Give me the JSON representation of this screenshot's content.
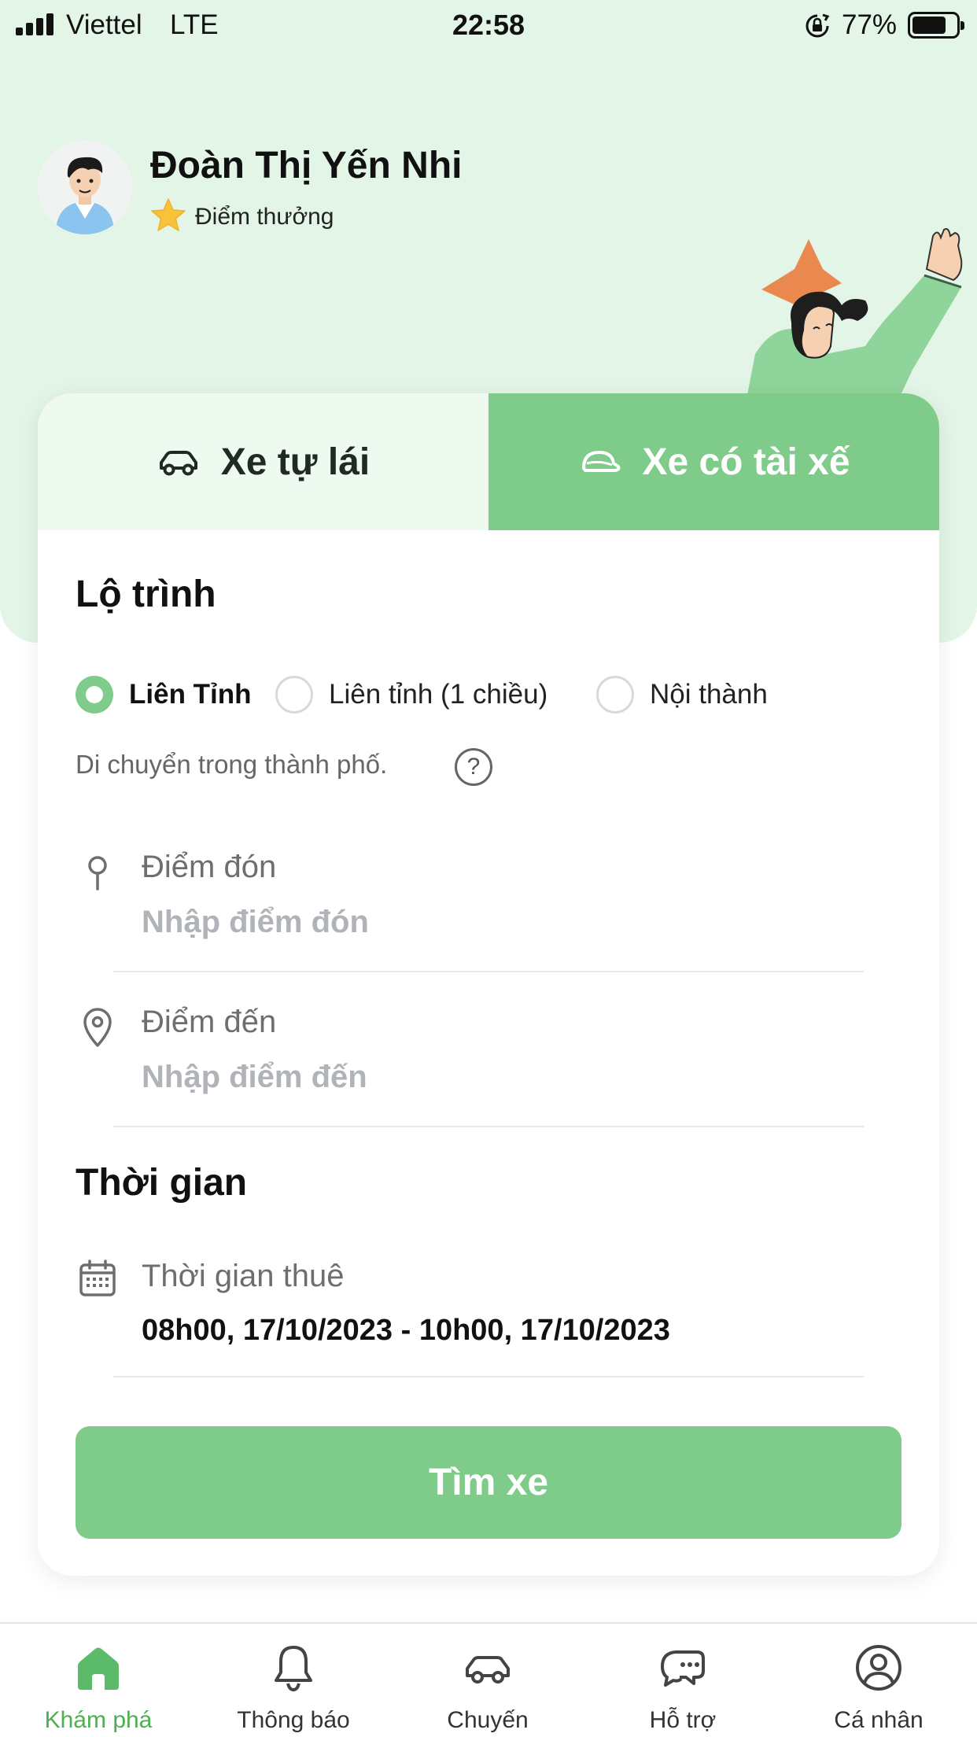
{
  "status_bar": {
    "carrier": "Viettel",
    "network": "LTE",
    "time": "22:58",
    "battery_percent": "77%",
    "battery_level": 0.77
  },
  "profile": {
    "name": "Đoàn Thị Yến Nhi",
    "points_label": "Điểm thưởng"
  },
  "tabs": {
    "self_drive": "Xe tự lái",
    "with_driver": "Xe có tài xế",
    "active": "with_driver"
  },
  "route": {
    "title": "Lộ trình",
    "options": [
      {
        "label": "Liên Tỉnh",
        "checked": true
      },
      {
        "label": "Liên tỉnh (1 chiều)",
        "checked": false
      },
      {
        "label": "Nội thành",
        "checked": false
      }
    ],
    "hint": "Di chuyển trong thành phố.",
    "pickup": {
      "label": "Điểm đón",
      "placeholder": "Nhập điểm đón"
    },
    "destination": {
      "label": "Điểm đến",
      "placeholder": "Nhập điểm đến"
    }
  },
  "time": {
    "title": "Thời gian",
    "rental_label": "Thời gian thuê",
    "rental_value": "08h00, 17/10/2023 - 10h00, 17/10/2023"
  },
  "search_button": "Tìm xe",
  "bottom_nav": [
    {
      "label": "Khám phá",
      "icon": "home-icon",
      "active": true
    },
    {
      "label": "Thông báo",
      "icon": "bell-icon",
      "active": false
    },
    {
      "label": "Chuyến",
      "icon": "car-icon",
      "active": false
    },
    {
      "label": "Hỗ trợ",
      "icon": "chat-icon",
      "active": false
    },
    {
      "label": "Cá nhân",
      "icon": "user-icon",
      "active": false
    }
  ],
  "colors": {
    "accent": "#7ecb8a",
    "hero_background": "#e3f5e7",
    "active_nav": "#4caf50"
  }
}
